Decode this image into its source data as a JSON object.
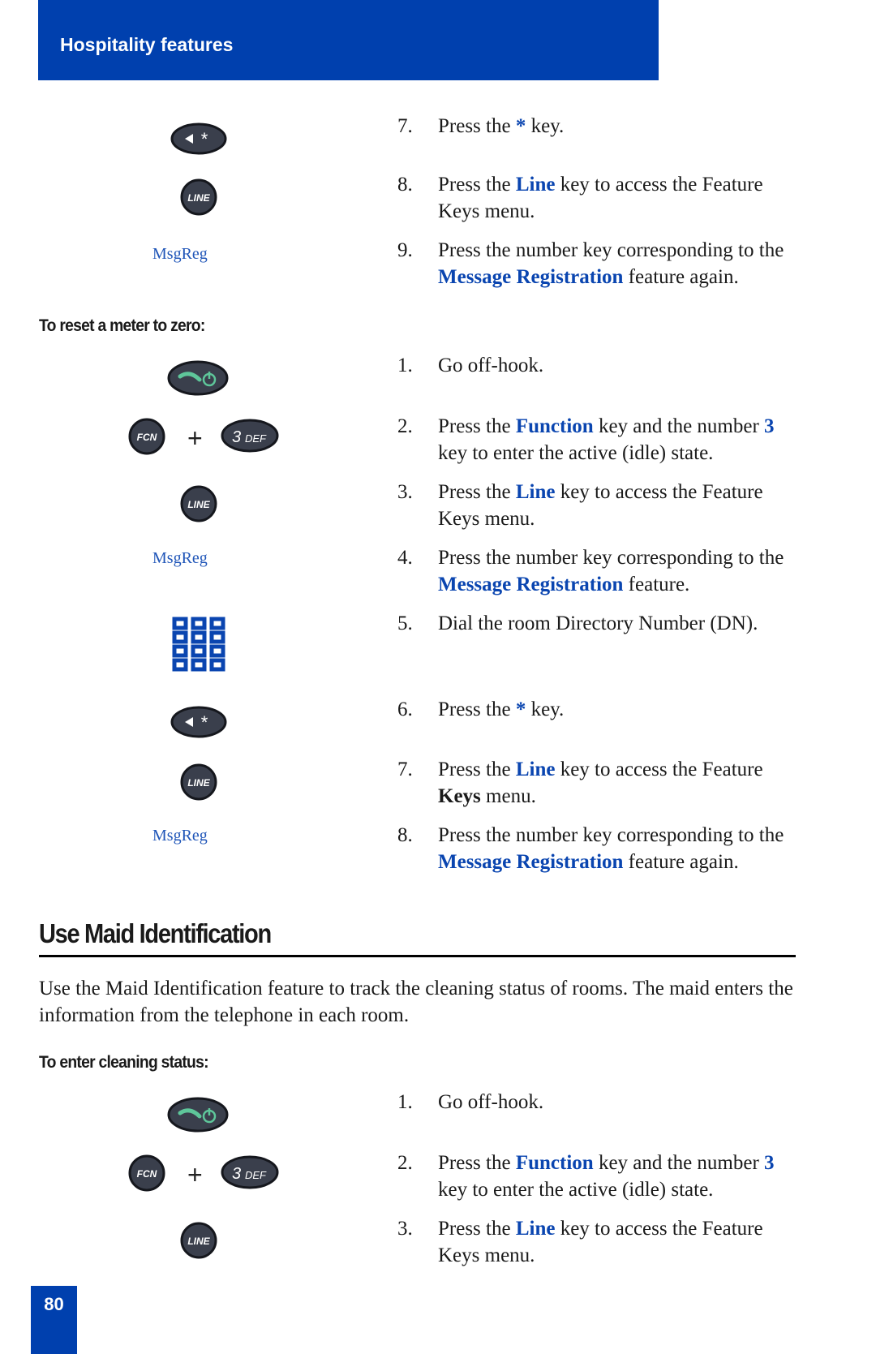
{
  "header": {
    "title": "Hospitality features",
    "color": "#0040ae"
  },
  "page_number": "80",
  "softkey_label": "MsgReg",
  "key_labels": {
    "line": "LINE",
    "fcn": "FCN",
    "three": "3",
    "three_sub": "DEF"
  },
  "plus": "+",
  "continued_steps": [
    {
      "num": "7.",
      "pre": "Press the ",
      "hl": "*",
      "post": " key."
    },
    {
      "num": "8.",
      "pre": "Press the ",
      "hl": "Line",
      "post": " key to access the Feature Keys menu."
    },
    {
      "num": "9.",
      "pre": "Press the number key corresponding to the ",
      "hl": "Message Registration",
      "post": " feature again."
    }
  ],
  "reset_heading": "To reset a meter to zero:",
  "reset_steps": [
    {
      "num": "1.",
      "text": "Go off-hook."
    },
    {
      "num": "2.",
      "pre": "Press the ",
      "hl": "Function",
      "mid": " key and the number ",
      "hl2": "3",
      "post": " key to enter the active (idle) state."
    },
    {
      "num": "3.",
      "pre": "Press the ",
      "hl": "Line",
      "post": " key to access the Feature Keys menu."
    },
    {
      "num": "4.",
      "pre": "Press the number key corresponding to the ",
      "hl": "Message Registration",
      "post": " feature."
    },
    {
      "num": "5.",
      "text": "Dial the room Directory Number (DN)."
    },
    {
      "num": "6.",
      "pre": "Press the ",
      "hl": "*",
      "post": " key."
    },
    {
      "num": "7.",
      "pre": "Press the ",
      "hl": "Line",
      "mid": " key to access the Feature ",
      "bold": "Keys",
      "post": " menu."
    },
    {
      "num": "8.",
      "pre": "Press the number key corresponding to the ",
      "hl": "Message Registration",
      "post": " feature again."
    }
  ],
  "section": {
    "title": "Use Maid Identification",
    "intro": "Use the Maid Identification feature to track the cleaning status of rooms. The maid enters the information from the telephone in each room."
  },
  "cleaning_heading": "To enter cleaning status:",
  "cleaning_steps": [
    {
      "num": "1.",
      "text": "Go off-hook."
    },
    {
      "num": "2.",
      "pre": "Press the ",
      "hl": "Function",
      "mid": " key and the number ",
      "hl2": "3",
      "post": " key to enter the active (idle) state."
    },
    {
      "num": "3.",
      "pre": "Press the ",
      "hl": "Line",
      "post": " key to access the Feature Keys menu."
    }
  ]
}
